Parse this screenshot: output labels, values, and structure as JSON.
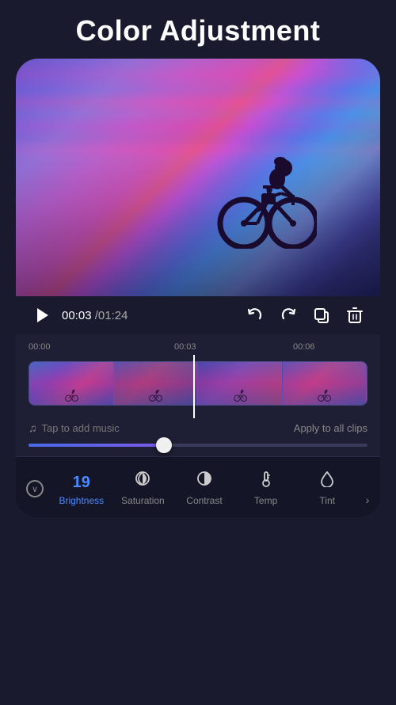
{
  "header": {
    "title": "Color Adjustment"
  },
  "controls": {
    "play_label": "play",
    "time_current": "00:03",
    "time_separator": "/",
    "time_total": "01:24",
    "undo_label": "undo",
    "redo_label": "redo",
    "copy_label": "copy",
    "delete_label": "delete"
  },
  "timeline": {
    "markers": [
      "00:00",
      "00:03",
      "00:06"
    ],
    "music_hint": "Tap to add music",
    "apply_hint": "Apply to all clips"
  },
  "tools": {
    "collapse_icon": "chevron-down",
    "items": [
      {
        "id": "brightness",
        "label": "Brightness",
        "value": "19",
        "has_value": true
      },
      {
        "id": "saturation",
        "label": "Saturation",
        "value": null,
        "icon": "saturation"
      },
      {
        "id": "contrast",
        "label": "Contrast",
        "value": null,
        "icon": "contrast"
      },
      {
        "id": "temp",
        "label": "Temp",
        "value": null,
        "icon": "temp"
      },
      {
        "id": "tint",
        "label": "Tint",
        "value": null,
        "icon": "tint"
      }
    ],
    "more_icon": "chevron-right"
  }
}
